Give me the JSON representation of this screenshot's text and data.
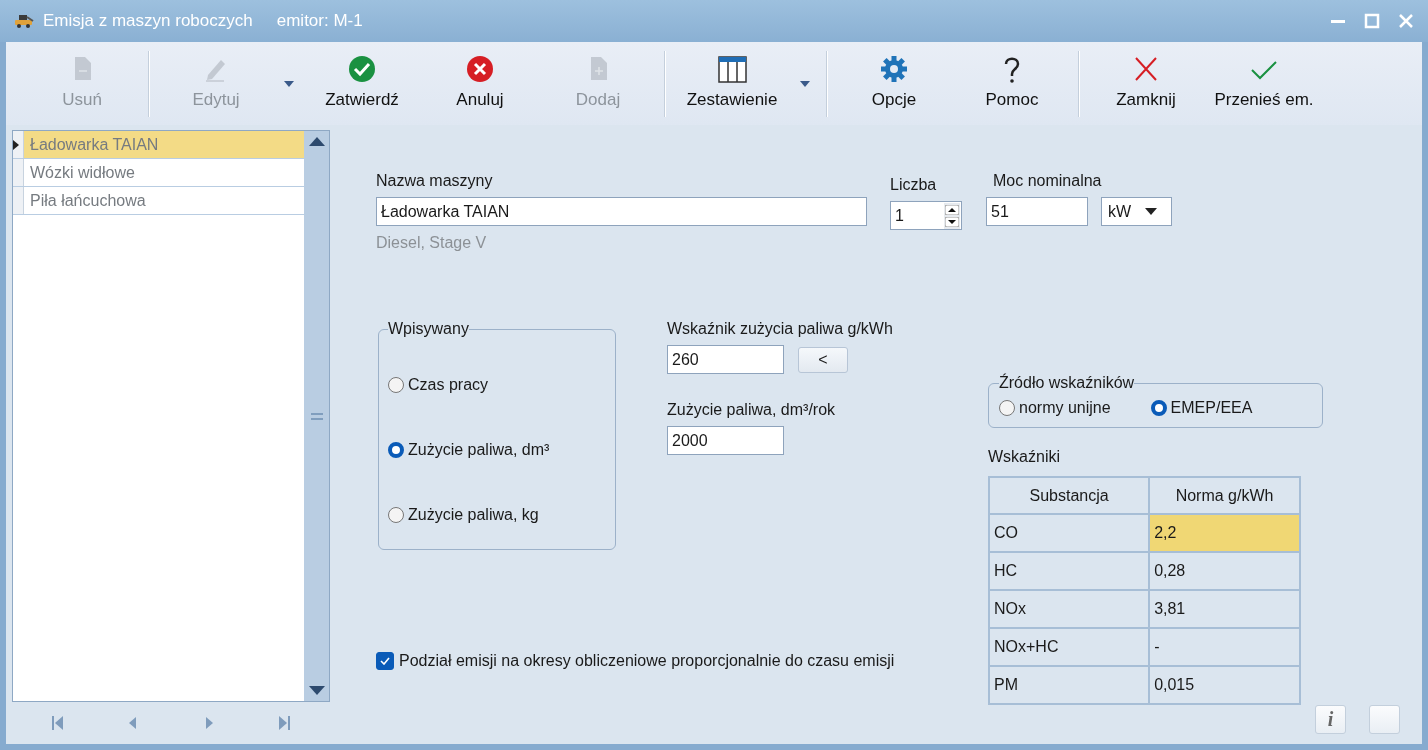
{
  "window": {
    "title": "Emisja z maszyn roboczych",
    "subtitle": "emitor: M-1"
  },
  "toolbar": {
    "groups": [
      {
        "items": [
          {
            "kind": "delete",
            "label": "Usuń",
            "disabled": true,
            "dropdown": false
          }
        ]
      },
      {
        "items": [
          {
            "kind": "edit",
            "label": "Edytuj",
            "disabled": true,
            "dropdown": true
          },
          {
            "kind": "confirm",
            "label": "Zatwierdź",
            "disabled": false,
            "dropdown": false
          },
          {
            "kind": "cancel",
            "label": "Anuluj",
            "disabled": false,
            "dropdown": false
          },
          {
            "kind": "add",
            "label": "Dodaj",
            "disabled": true,
            "dropdown": false
          }
        ]
      },
      {
        "items": [
          {
            "kind": "report",
            "label": "Zestawienie",
            "disabled": false,
            "dropdown": true
          }
        ]
      },
      {
        "items": [
          {
            "kind": "options",
            "label": "Opcje",
            "disabled": false,
            "dropdown": false
          },
          {
            "kind": "help",
            "label": "Pomoc",
            "disabled": false,
            "dropdown": false
          }
        ]
      },
      {
        "items": [
          {
            "kind": "close",
            "label": "Zamknij",
            "disabled": false,
            "dropdown": false
          },
          {
            "kind": "transfer",
            "label": "Przenieś em.",
            "disabled": false,
            "dropdown": false
          }
        ]
      }
    ]
  },
  "list": {
    "items": [
      {
        "label": "Ładowarka TAIAN",
        "selected": true
      },
      {
        "label": "Wózki widłowe",
        "selected": false
      },
      {
        "label": "Piła łańcuchowa",
        "selected": false
      }
    ]
  },
  "form": {
    "name_label": "Nazwa maszyny",
    "name_value": "Ładowarka TAIAN",
    "hint": "Diesel, Stage V",
    "count_label": "Liczba",
    "count_value": "1",
    "power_label": "Moc nominalna",
    "power_value": "51",
    "power_unit": "kW"
  },
  "entry_mode": {
    "title": "Wpisywany",
    "options": [
      {
        "label": "Czas pracy",
        "selected": false
      },
      {
        "label": "Zużycie paliwa, dm³",
        "selected": true
      },
      {
        "label": "Zużycie paliwa, kg",
        "selected": false
      }
    ]
  },
  "fuel_rate": {
    "label": "Wskaźnik zużycia paliwa g/kWh",
    "value": "260",
    "button": "<"
  },
  "fuel_use": {
    "label": "Zużycie paliwa, dm³/rok",
    "value": "2000"
  },
  "source": {
    "title": "Źródło wskaźników",
    "options": [
      {
        "label": "normy unijne",
        "selected": false
      },
      {
        "label": "EMEP/EEA",
        "selected": true
      }
    ]
  },
  "factors": {
    "title": "Wskaźniki",
    "columns": [
      "Substancja",
      "Norma g/kWh"
    ],
    "rows": [
      {
        "substance": "CO",
        "value": "2,2",
        "selected": true
      },
      {
        "substance": "HC",
        "value": "0,28",
        "selected": false
      },
      {
        "substance": "NOx",
        "value": "3,81",
        "selected": false
      },
      {
        "substance": "NOx+HC",
        "value": "-",
        "selected": false
      },
      {
        "substance": "PM",
        "value": "0,015",
        "selected": false
      }
    ]
  },
  "split_checkbox": {
    "label": "Podział emisji na okresy obliczeniowe proporcjonalnie do czasu emisji",
    "checked": true
  },
  "footer": {
    "info_button": "i"
  }
}
